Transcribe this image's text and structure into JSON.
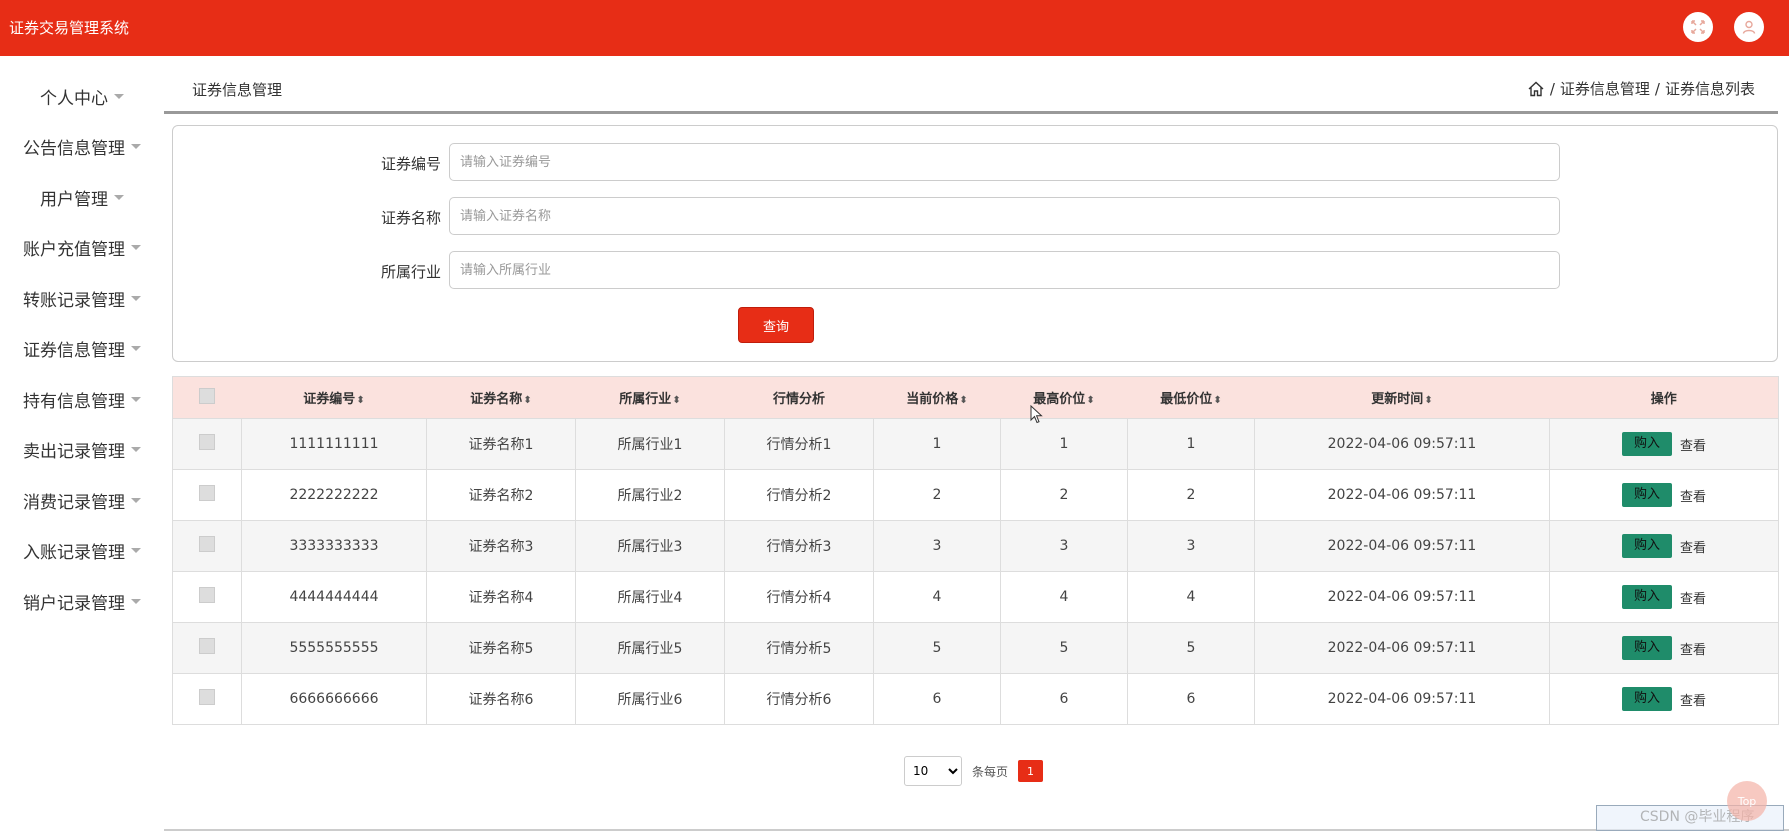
{
  "header": {
    "app_title": "证券交易管理系统",
    "icons": [
      "fullscreen-icon",
      "user-avatar-icon"
    ]
  },
  "sidebar": {
    "items": [
      {
        "label": "个人中心"
      },
      {
        "label": "公告信息管理"
      },
      {
        "label": "用户管理"
      },
      {
        "label": "账户充值管理"
      },
      {
        "label": "转账记录管理"
      },
      {
        "label": "证券信息管理"
      },
      {
        "label": "持有信息管理"
      },
      {
        "label": "卖出记录管理"
      },
      {
        "label": "消费记录管理"
      },
      {
        "label": "入账记录管理"
      },
      {
        "label": "销户记录管理"
      }
    ]
  },
  "page": {
    "title": "证券信息管理",
    "breadcrumb": [
      "证券信息管理",
      "证券信息列表"
    ],
    "separator": "/"
  },
  "search": {
    "fields": [
      {
        "label": "证券编号",
        "placeholder": "请输入证券编号"
      },
      {
        "label": "证券名称",
        "placeholder": "请输入证券名称"
      },
      {
        "label": "所属行业",
        "placeholder": "请输入所属行业"
      }
    ],
    "query_label": "查询"
  },
  "table": {
    "headers": [
      "证券编号",
      "证券名称",
      "所属行业",
      "行情分析",
      "当前价格",
      "最高价位",
      "最低价位",
      "更新时间",
      "操作"
    ],
    "rows": [
      [
        "1111111111",
        "证券名称1",
        "所属行业1",
        "行情分析1",
        "1",
        "1",
        "1",
        "2022-04-06 09:57:11"
      ],
      [
        "2222222222",
        "证券名称2",
        "所属行业2",
        "行情分析2",
        "2",
        "2",
        "2",
        "2022-04-06 09:57:11"
      ],
      [
        "3333333333",
        "证券名称3",
        "所属行业3",
        "行情分析3",
        "3",
        "3",
        "3",
        "2022-04-06 09:57:11"
      ],
      [
        "4444444444",
        "证券名称4",
        "所属行业4",
        "行情分析4",
        "4",
        "4",
        "4",
        "2022-04-06 09:57:11"
      ],
      [
        "5555555555",
        "证券名称5",
        "所属行业5",
        "行情分析5",
        "5",
        "5",
        "5",
        "2022-04-06 09:57:11"
      ],
      [
        "6666666666",
        "证券名称6",
        "所属行业6",
        "行情分析6",
        "6",
        "6",
        "6",
        "2022-04-06 09:57:11"
      ]
    ],
    "buy_label": "购入",
    "view_label": "查看"
  },
  "pagination": {
    "page_size": "10",
    "page_size_label": "条每页",
    "current_page": "1"
  },
  "overlay": {
    "watermark": "CSDN @毕业程序",
    "top_button": "Top"
  },
  "colors": {
    "brand": "#e72d16",
    "header_row": "#fbe2de",
    "buy_button": "#1f8c6a"
  }
}
